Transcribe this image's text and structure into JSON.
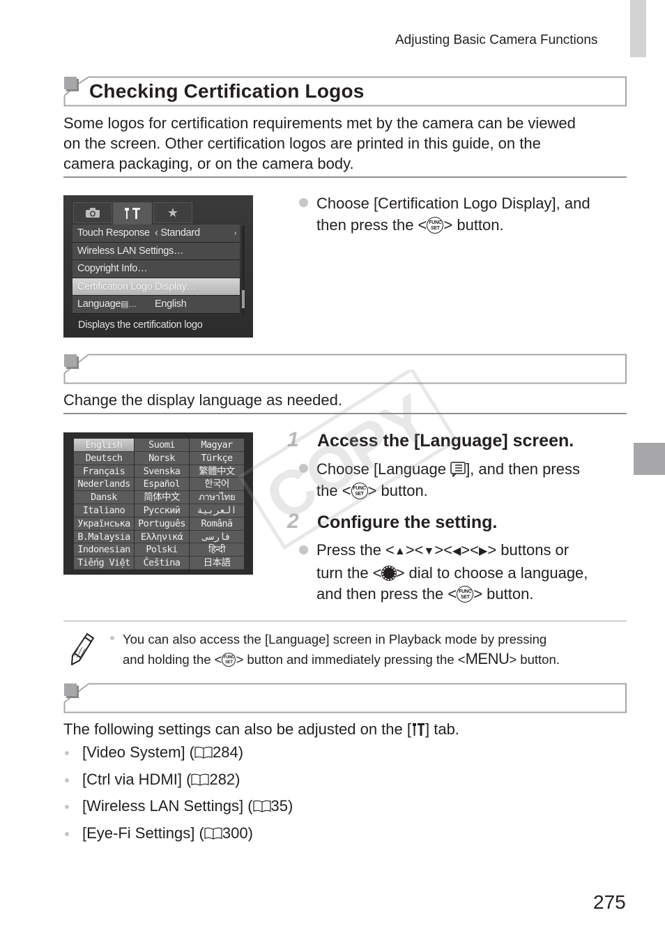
{
  "header": {
    "running_head": "Adjusting Basic Camera Functions"
  },
  "section1": {
    "title": "Checking Certification Logos",
    "intro_lines": [
      "Some logos for certification requirements met by the camera can be viewed",
      "on the screen. Other certification logos are printed in this guide, on the",
      "camera packaging, or on the camera body."
    ],
    "screen": {
      "tabs": [
        "camera-tab",
        "setup-tab",
        "my-menu-tab"
      ],
      "active_tab": "setup-tab",
      "rows": [
        {
          "label": "Touch Response",
          "value": "‹ Standard",
          "arrow": "›"
        },
        {
          "label": "Wireless LAN Settings…",
          "value": "",
          "arrow": ""
        },
        {
          "label": "Copyright Info…",
          "value": "",
          "arrow": ""
        },
        {
          "label": "Certification Logo Display…",
          "value": "",
          "arrow": "",
          "selected": true
        },
        {
          "label": "Language",
          "value": "English",
          "arrow": ""
        }
      ],
      "help_text": "Displays the certification logo"
    },
    "instruction": {
      "line1": "Choose [Certification Logo Display], and",
      "line2_pre": "then press the <",
      "line2_post": "> button."
    }
  },
  "section2": {
    "title": "",
    "intro": "Change the display language as needed.",
    "language_grid": [
      [
        "English",
        "Suomi",
        "Magyar"
      ],
      [
        "Deutsch",
        "Norsk",
        "Türkçe"
      ],
      [
        "Français",
        "Svenska",
        "繁體中文"
      ],
      [
        "Nederlands",
        "Español",
        "한국어"
      ],
      [
        "Dansk",
        "简体中文",
        "ภาษาไทย"
      ],
      [
        "Italiano",
        "Русский",
        "العربية"
      ],
      [
        "Українська",
        "Português",
        "Română"
      ],
      [
        "B.Malaysia",
        "Ελληνικά",
        "فارسی"
      ],
      [
        "Indonesian",
        "Polski",
        "हिन्दी"
      ],
      [
        "Tiếng Việt",
        "Čeština",
        "日本語"
      ]
    ],
    "selected_language": "English",
    "steps": [
      {
        "number": "1",
        "heading": "Access the [Language] screen.",
        "text_pre": "Choose [Language ",
        "text_mid": "], and then press",
        "text_line2_pre": "the <",
        "text_line2_post": "> button."
      },
      {
        "number": "2",
        "heading": "Configure the setting.",
        "line1_pre": "Press the <",
        "line1_post": "> buttons or",
        "line2_pre": "turn the <",
        "line2_post": "> dial to choose a language,",
        "line3_pre": "and then press the <",
        "line3_post": "> button."
      }
    ],
    "note": {
      "line1": "You can also access the [Language] screen in Playback mode by pressing",
      "line2_pre": "and holding the <",
      "line2_mid": "> button and immediately pressing the <",
      "menu_label": "MENU",
      "line2_post": "> button."
    }
  },
  "section3": {
    "title": "",
    "intro_pre": "The following settings can also be adjusted on the [",
    "intro_post": "] tab.",
    "items": [
      {
        "label": "[Video System] (",
        "page": "284",
        "close": ")"
      },
      {
        "label": "[Ctrl via HDMI] (",
        "page": "282",
        "close": ")"
      },
      {
        "label": "[Wireless LAN Settings] (",
        "page": "35",
        "close": ")"
      },
      {
        "label": "[Eye-Fi Settings] (",
        "page": "300",
        "close": ")"
      }
    ]
  },
  "func_button": {
    "line1": "FUNC",
    "line2": "SET"
  },
  "watermark": "COPY",
  "page_number": "275"
}
